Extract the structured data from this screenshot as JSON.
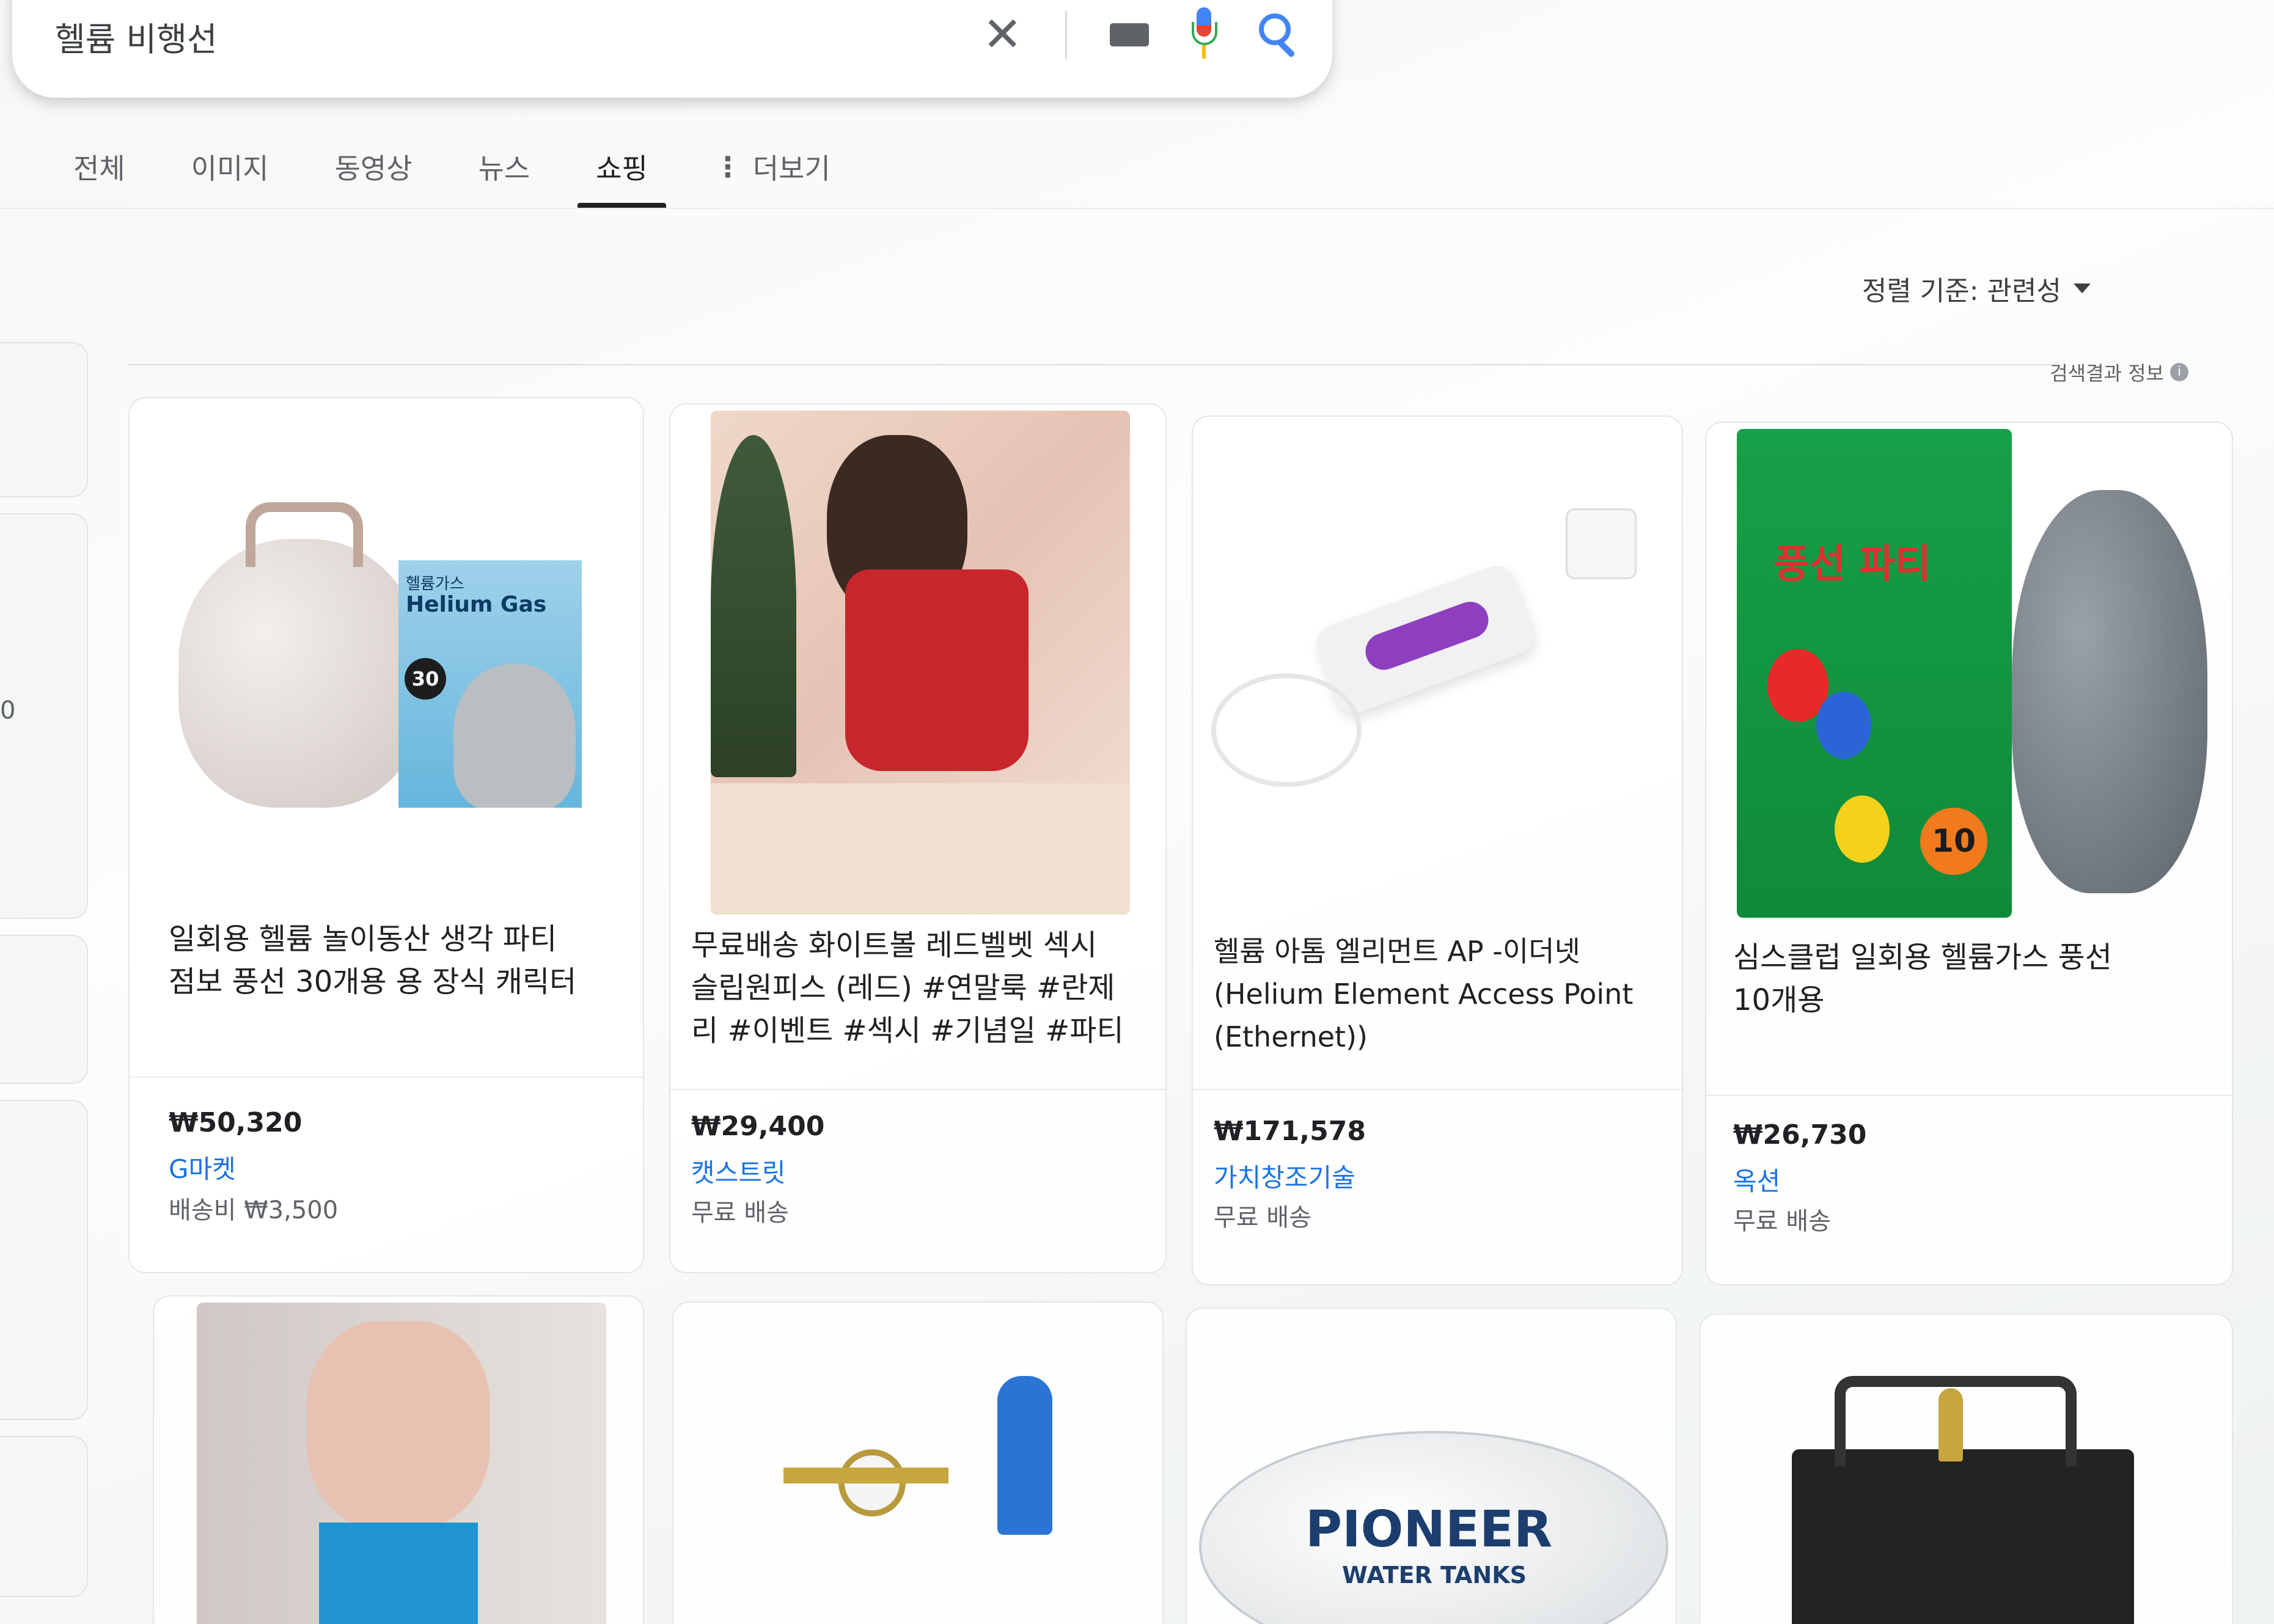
{
  "search": {
    "query": "헬륨 비행선",
    "clear_label": "✕"
  },
  "tabs": [
    {
      "label": "전체"
    },
    {
      "label": "이미지"
    },
    {
      "label": "동영상"
    },
    {
      "label": "뉴스"
    },
    {
      "label": "쇼핑",
      "active": true
    },
    {
      "label": "더보기",
      "icon": "more-vert-icon"
    }
  ],
  "sort": {
    "label": "정렬 기준: 관련성"
  },
  "about": {
    "label": "검색결과 정보"
  },
  "left_rail": {
    "fragment": "0"
  },
  "products": [
    {
      "title_line1": "일회용 헬륨 놀이동산 생각 파티",
      "title_line2": "점보 풍선 30개용 용 장식 캐릭터",
      "price": "₩50,320",
      "seller": "G마켓",
      "shipping": "배송비 ₩3,500",
      "image_labels": {
        "box_title": "Helium Gas",
        "box_top": "헬륨가스",
        "badge": "30"
      }
    },
    {
      "title_line1": "무료배송 화이트볼 레드벨벳 섹시",
      "title_line2": "슬립원피스 (레드) #연말룩 #란제",
      "title_line3": "리 #이벤트 #섹시 #기념일 #파티",
      "price": "₩29,400",
      "seller": "캣스트릿",
      "shipping": "무료 배송"
    },
    {
      "title_line1": "헬륨 아톰 엘리먼트 AP -이더넷",
      "title_line2": "(Helium Element Access Point",
      "title_line3": "(Ethernet))",
      "price": "₩171,578",
      "seller": "가치창조기술",
      "shipping": "무료 배송"
    },
    {
      "title_line1": "심스클럽 일회용 헬륨가스 풍선",
      "title_line2": "10개용",
      "price": "₩26,730",
      "seller": "옥션",
      "shipping": "무료 배송",
      "image_labels": {
        "box_title": "풍선 파티",
        "badge": "10"
      }
    }
  ],
  "bottom_row": [
    {
      "image": "lingerie-photo"
    },
    {
      "image": "regulator-valve-photo"
    },
    {
      "image": "pioneer-blimp-photo",
      "image_labels": {
        "brand": "PIONEER",
        "sub": "WATER TANKS"
      }
    },
    {
      "image": "balloon-machine-photo"
    }
  ],
  "colors": {
    "link": "#1a73e8",
    "text": "#202124",
    "muted": "#5f6368",
    "google_blue": "#4285f4",
    "google_red": "#ea4335",
    "google_green": "#34a853",
    "google_yellow": "#fbbc04"
  }
}
